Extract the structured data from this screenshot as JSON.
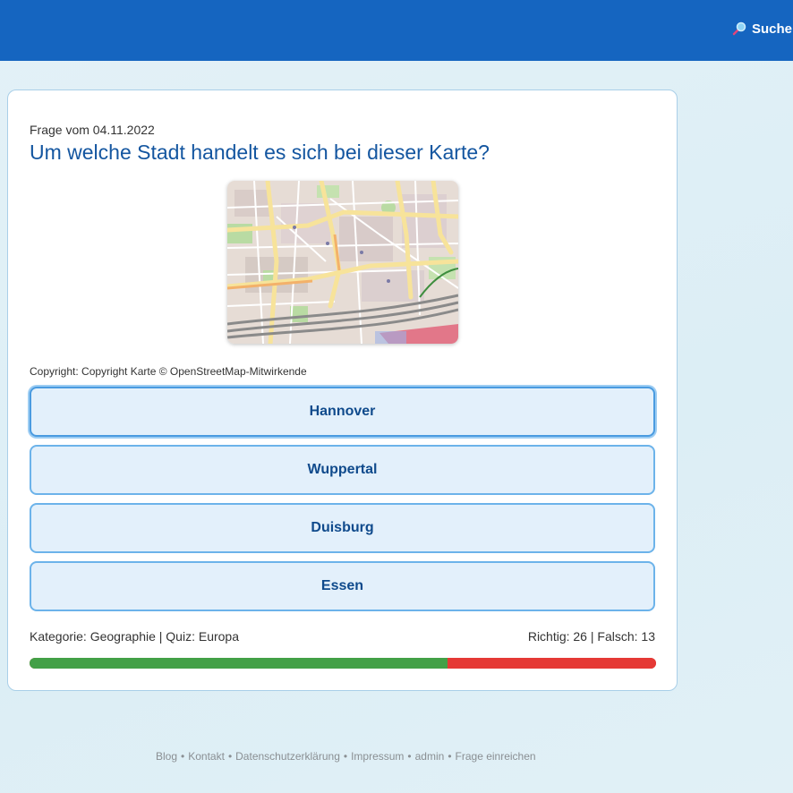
{
  "header": {
    "search_label": "Suche",
    "search_icon": "magnifier-icon",
    "bg_color": "#1565c0"
  },
  "quiz": {
    "date_text": "Frage vom 04.11.2022",
    "question": "Um welche Stadt handelt es sich bei dieser Karte?",
    "copyright": "Copyright: Copyright Karte © OpenStreetMap-Mitwirkende",
    "answers": [
      {
        "label": "Hannover"
      },
      {
        "label": "Wuppertal"
      },
      {
        "label": "Duisburg"
      },
      {
        "label": "Essen"
      }
    ],
    "category_label": "Kategorie: Geographie",
    "quiz_label": "Quiz: Europa",
    "separator": " | ",
    "correct_label": "Richtig: 26",
    "wrong_label": "Falsch: 13",
    "correct_count": 26,
    "wrong_count": 13,
    "correct_color": "#43a047",
    "wrong_color": "#e53935"
  },
  "footer": {
    "links": [
      "Blog",
      "Kontakt",
      "Datenschutzerklärung",
      "Impressum",
      "admin",
      "Frage einreichen"
    ],
    "separator": "•"
  }
}
